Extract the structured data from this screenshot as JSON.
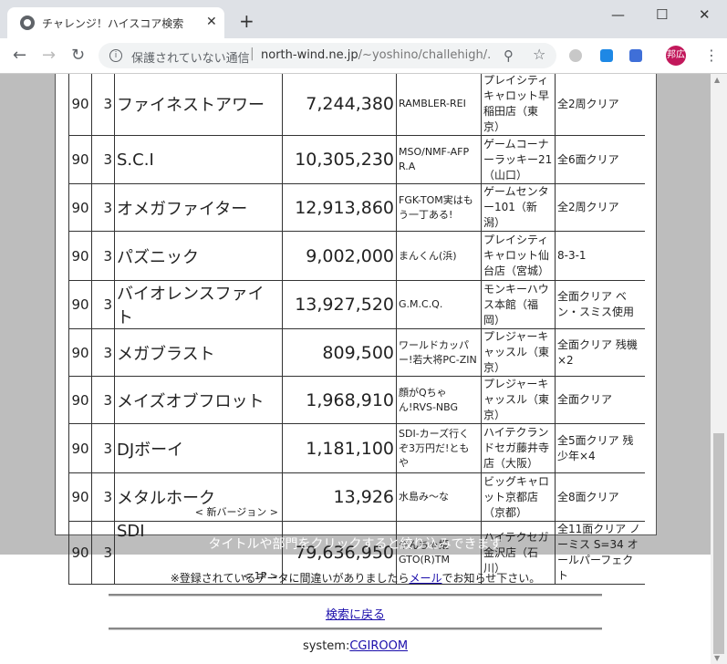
{
  "browser": {
    "tab_title": "チャレンジ！ハイスコア検索",
    "close_glyph": "✕",
    "new_tab_glyph": "+",
    "minimize_glyph": "—",
    "maximize_glyph": "☐",
    "window_close_glyph": "✕",
    "security_label": "保護されていない通信",
    "url_domain": "north-wind.ne.jp",
    "url_path": "/~yoshino/challehigh/...",
    "profile_initials": "邦広"
  },
  "table": {
    "rows": [
      {
        "level": "90",
        "players": "3",
        "title": "ファイネストアワー",
        "version": "",
        "score": "7,244,380",
        "name": "RAMBLER-REI",
        "place": "プレイシティキャロット早稲田店（東京）",
        "note": "全2周クリア"
      },
      {
        "level": "90",
        "players": "3",
        "title": "S.C.I",
        "version": "",
        "score": "10,305,230",
        "name": "MSO/NMF-AFP R.A",
        "place": "ゲームコーナーラッキー21（山口）",
        "note": "全6面クリア"
      },
      {
        "level": "90",
        "players": "3",
        "title": "オメガファイター",
        "version": "",
        "score": "12,913,860",
        "name": "FGK-TOM実はもう一丁ある!",
        "place": "ゲームセンター101（新潟）",
        "note": "全2周クリア"
      },
      {
        "level": "90",
        "players": "3",
        "title": "パズニック",
        "version": "",
        "score": "9,002,000",
        "name": "まんくん(浜)",
        "place": "プレイシティキャロット仙台店（宮城）",
        "note": "8-3-1"
      },
      {
        "level": "90",
        "players": "3",
        "title": "バイオレンスファイト",
        "version": "",
        "score": "13,927,520",
        "name": "G.M.C.Q.",
        "place": "モンキーハウス本館（福岡）",
        "note": "全面クリア ベン・スミス使用"
      },
      {
        "level": "90",
        "players": "3",
        "title": "メガブラスト",
        "version": "",
        "score": "809,500",
        "name": "ワールドカッパー!若大将PC-ZIN",
        "place": "プレジャーキャッスル（東京）",
        "note": "全面クリア 残機×2"
      },
      {
        "level": "90",
        "players": "3",
        "title": "メイズオブフロット",
        "version": "",
        "score": "1,968,910",
        "name": "顔がQちゃん!RVS-NBG",
        "place": "プレジャーキャッスル（東京）",
        "note": "全面クリア"
      },
      {
        "level": "90",
        "players": "3",
        "title": "DJボーイ",
        "version": "",
        "score": "1,181,100",
        "name": "SDI-カーズ行くぞ3万円だ!ともや",
        "place": "ハイテクランドセガ藤井寺店（大阪）",
        "note": "全5面クリア 残少年×4"
      },
      {
        "level": "90",
        "players": "3",
        "title": "メタルホーク",
        "version": "< 新バージョン >",
        "score": "13,926",
        "name": "水島み〜な",
        "place": "ビッグキャロット京都店（京都）",
        "note": "全8面クリア"
      },
      {
        "level": "90",
        "players": "3",
        "title": "SDI",
        "version": "< 1P >",
        "score": "79,636,950",
        "name": "やんちゃ姫GTO(R)TM",
        "place": "ハイテクセガ金沢店（石川）",
        "note": "全11面クリア ノーミス S=34 オールパーフェクト"
      }
    ]
  },
  "page": {
    "hint": "タイトルや部門をクリックすると絞り込みできます",
    "error_note_before": "※登録されているデータに間違いがありましたら",
    "mail_link": "メール",
    "error_note_after": "でお知らせ下さい。",
    "back_link": "検索に戻る",
    "system_label": "system:",
    "system_link": "CGIROOM"
  }
}
